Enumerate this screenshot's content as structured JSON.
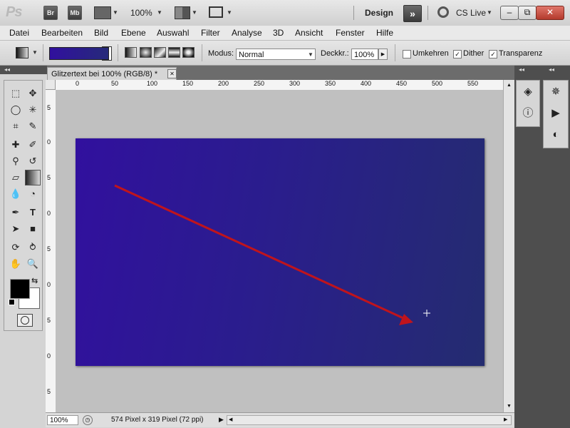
{
  "appbar": {
    "logo": "Ps",
    "bridge_label": "Br",
    "minibridge_label": "Mb",
    "zoom_value": "100%",
    "workspace": "Design",
    "cs_live": "CS Live",
    "minimize": "–",
    "restore": "⧉",
    "close": "✕"
  },
  "menu": {
    "items": [
      "Datei",
      "Bearbeiten",
      "Bild",
      "Ebene",
      "Auswahl",
      "Filter",
      "Analyse",
      "3D",
      "Ansicht",
      "Fenster",
      "Hilfe"
    ]
  },
  "options": {
    "modus_label": "Modus:",
    "modus_value": "Normal",
    "deckkraft_label": "Deckkr.:",
    "deckkraft_value": "100%",
    "umkehren_label": "Umkehren",
    "dither_label": "Dither",
    "transparenz_label": "Transparenz",
    "umkehren_checked": false,
    "dither_checked": true,
    "transparenz_checked": true,
    "gradient_colors": [
      "#31109e",
      "#262a7a"
    ]
  },
  "document": {
    "tab_title": "Glitzertext bei 100% (RGB/8) *",
    "tab_close": "✕",
    "image_colors": [
      "#31109e",
      "#242c70"
    ],
    "arrow_color": "#c0141c"
  },
  "ruler": {
    "h_ticks": [
      "0",
      "50",
      "100",
      "150",
      "200",
      "250",
      "300",
      "350",
      "400",
      "450",
      "500",
      "550"
    ],
    "v_ticks": [
      "5",
      "0",
      "5",
      "0",
      "5",
      "0",
      "5",
      "0",
      "5",
      "0",
      "5",
      "0",
      "5",
      "0",
      "5",
      "0"
    ]
  },
  "status": {
    "zoom": "100%",
    "info": "574 Pixel x 319 Pixel (72 ppi)"
  },
  "colors": {
    "foreground": "#000000",
    "background": "#ffffff"
  }
}
